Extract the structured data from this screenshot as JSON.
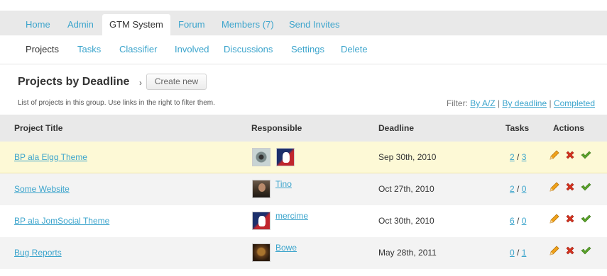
{
  "nav": {
    "tabs": [
      {
        "label": "Home"
      },
      {
        "label": "Admin"
      },
      {
        "label": "GTM System",
        "active": true
      },
      {
        "label": "Forum"
      },
      {
        "label": "Members (7)"
      },
      {
        "label": "Send Invites"
      }
    ]
  },
  "subnav": {
    "items": [
      {
        "label": "Projects",
        "active": true
      },
      {
        "label": "Tasks"
      },
      {
        "label": "Classifier"
      },
      {
        "label": "Involved"
      },
      {
        "label": "Discussions"
      },
      {
        "label": "Settings"
      },
      {
        "label": "Delete"
      }
    ]
  },
  "page": {
    "title": "Projects by Deadline",
    "chevron": "›",
    "create_button": "Create new",
    "description": "List of projects in this group. Use links in the right to filter them.",
    "filter": {
      "label": "Filter:",
      "by_az": "By A/Z",
      "sep1": "|",
      "by_deadline": "By deadline",
      "sep2": "|",
      "completed": "Completed"
    }
  },
  "table": {
    "headers": {
      "title": "Project Title",
      "responsible": "Responsible",
      "deadline": "Deadline",
      "tasks": "Tasks",
      "actions": "Actions"
    },
    "rows": [
      {
        "title": "BP ala Elgg Theme",
        "user": "",
        "deadline": "Sep 30th, 2010",
        "tasks_done": "2",
        "tasks_sep": "/",
        "tasks_total": "3"
      },
      {
        "title": "Some Website",
        "user": "Tino",
        "deadline": "Oct 27th, 2010",
        "tasks_done": "2",
        "tasks_sep": "/",
        "tasks_total": "0"
      },
      {
        "title": "BP ala JomSocial Theme",
        "user": "mercime",
        "deadline": "Oct 30th, 2010",
        "tasks_done": "6",
        "tasks_sep": "/",
        "tasks_total": "0"
      },
      {
        "title": "Bug Reports",
        "user": "Bowe",
        "deadline": "May 28th, 2011",
        "tasks_done": "0",
        "tasks_sep": "/",
        "tasks_total": "1"
      }
    ]
  },
  "colors": {
    "link": "#3ba4cc",
    "edit": "#f0a21a",
    "delete": "#d6321f",
    "complete": "#5aa32a"
  },
  "icons": {
    "edit": "pencil-icon",
    "delete": "delete-x-icon",
    "complete": "checkmark-icon"
  }
}
